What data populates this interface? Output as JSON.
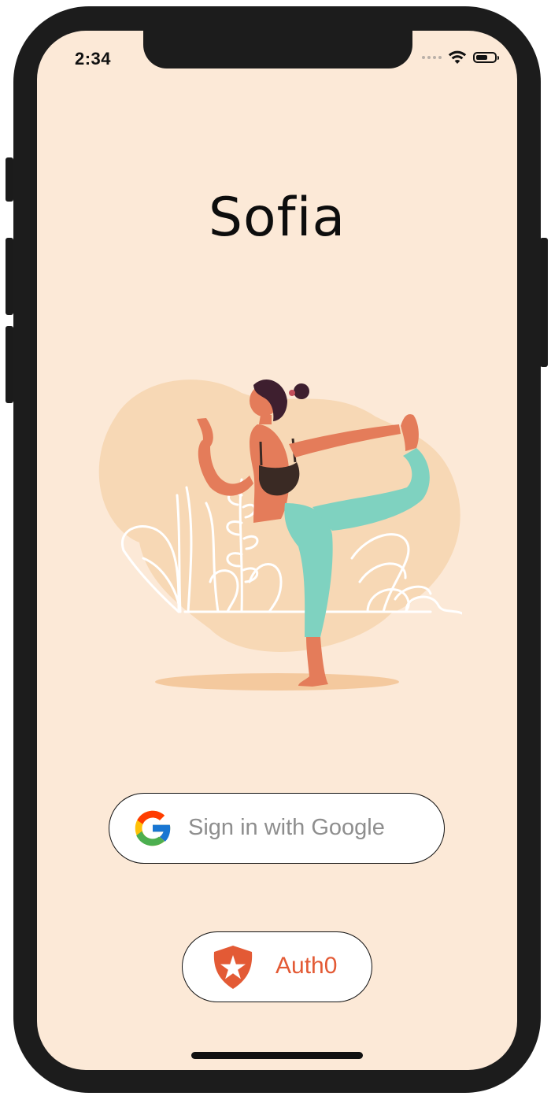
{
  "status_bar": {
    "time": "2:34"
  },
  "app": {
    "title": "Sofia"
  },
  "buttons": {
    "google_label": "Sign in with Google",
    "auth0_label": "Auth0"
  },
  "colors": {
    "background": "#fce9d7",
    "frame": "#1c1c1c",
    "auth0_accent": "#e35a35",
    "google_text": "#8e8e8e",
    "blob": "#f7d8b5",
    "leggings": "#7fd2c0",
    "skin": "#e47c5a"
  },
  "icons": [
    "wifi-icon",
    "battery-icon",
    "google-logo-icon",
    "auth0-shield-icon"
  ]
}
